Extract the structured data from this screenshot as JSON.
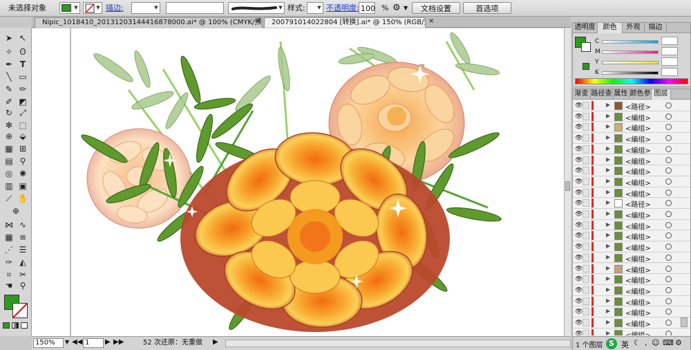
{
  "control_bar": {
    "selection_label": "未选择对象",
    "stroke_label": "描边:",
    "style_label": "样式:",
    "opacity_label": "不透明度:",
    "opacity_value": "100",
    "opacity_unit": "%",
    "doc_setup_button": "文档设置",
    "preferences_button": "首选项",
    "fill_color": "#2e9a1e"
  },
  "document_tabs": [
    {
      "label": "Nipic_1018410_20131203144416878000.ai* @ 100% (CMYK/预览)"
    },
    {
      "label": "200791014022804 [转换].ai* @ 150% (RGB/预览)"
    }
  ],
  "status_bar": {
    "zoom": "150%",
    "page": "1",
    "message": "52 次还原：无重做"
  },
  "color_panel": {
    "tabs": [
      "透明度",
      "颜色",
      "外观",
      "描边"
    ],
    "channels": [
      "C",
      "M",
      "Y",
      "K"
    ],
    "fill_color": "#2e9a1e"
  },
  "layers_panel": {
    "tabs": [
      "渐变",
      "路径查",
      "属性",
      "颜色参",
      "图层"
    ],
    "rows": [
      {
        "name": "<路径>"
      },
      {
        "name": "<编组>"
      },
      {
        "name": "<编组>"
      },
      {
        "name": "<编组>"
      },
      {
        "name": "<编组>"
      },
      {
        "name": "<编组>"
      },
      {
        "name": "<编组>"
      },
      {
        "name": "<编组>"
      },
      {
        "name": "<编组>"
      },
      {
        "name": "<路径>"
      },
      {
        "name": "<编组>"
      },
      {
        "name": "<编组>"
      },
      {
        "name": "<编组>"
      },
      {
        "name": "<编组>"
      },
      {
        "name": "<编组>"
      },
      {
        "name": "<编组>"
      },
      {
        "name": "<编组>"
      },
      {
        "name": "<编组>"
      },
      {
        "name": "<编组>"
      },
      {
        "name": "<编组>"
      },
      {
        "name": "<编组>"
      },
      {
        "name": "<编组>"
      }
    ],
    "footer_label": "1 个图层",
    "ime_label": "英"
  }
}
